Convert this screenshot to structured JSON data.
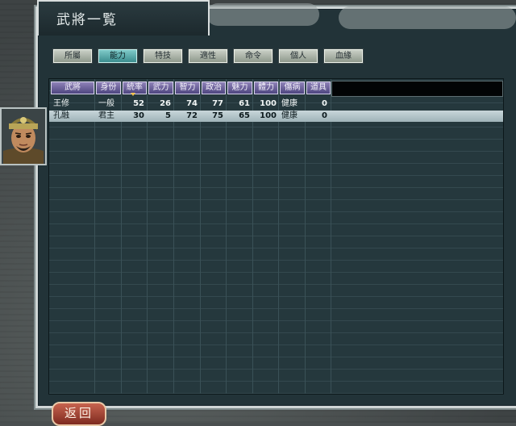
{
  "window": {
    "title": "武將一覧"
  },
  "tabs": [
    {
      "label": "所屬",
      "active": false
    },
    {
      "label": "能力",
      "active": true
    },
    {
      "label": "特技",
      "active": false
    },
    {
      "label": "適性",
      "active": false
    },
    {
      "label": "命令",
      "active": false
    },
    {
      "label": "個人",
      "active": false
    },
    {
      "label": "血緣",
      "active": false
    }
  ],
  "table": {
    "columns": [
      "武將",
      "身份",
      "統率",
      "武力",
      "智力",
      "政治",
      "魅力",
      "體力",
      "傷病",
      "道具"
    ],
    "sort_column": "統率",
    "rows": [
      {
        "name": "王修",
        "rank": "一般",
        "tongshuai": "52",
        "wuli": "26",
        "zhili": "74",
        "zhengzhi": "77",
        "meili": "61",
        "tili": "100",
        "status": "健康",
        "items": "0",
        "selected": false
      },
      {
        "name": "孔融",
        "rank": "君主",
        "tongshuai": "30",
        "wuli": "5",
        "zhili": "72",
        "zhengzhi": "75",
        "meili": "65",
        "tili": "100",
        "status": "健康",
        "items": "0",
        "selected": true
      }
    ]
  },
  "footer": {
    "back_label": "返回"
  },
  "colors": {
    "selected_row": "#c8d6da",
    "header_cell": "#8f82b8",
    "active_tab": "#7fc9c8"
  }
}
